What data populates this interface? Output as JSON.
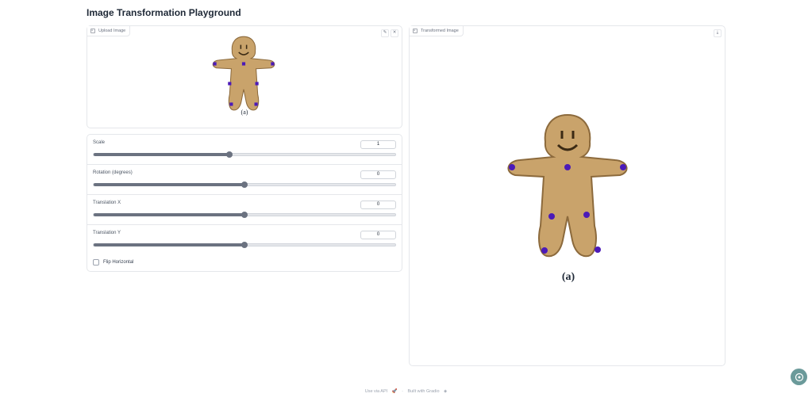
{
  "app": {
    "title": "Image Transformation Playground"
  },
  "upload": {
    "label": "Upload Image",
    "caption": "(a)"
  },
  "output": {
    "label": "Transformed Image",
    "caption": "(a)"
  },
  "controls": {
    "scale": {
      "label": "Scale",
      "value": "1",
      "fraction": 0.45
    },
    "rotation": {
      "label": "Rotation (degrees)",
      "value": "0",
      "fraction": 0.5
    },
    "translate_x": {
      "label": "Translation X",
      "value": "0",
      "fraction": 0.5
    },
    "translate_y": {
      "label": "Translation Y",
      "value": "0",
      "fraction": 0.5
    },
    "flip": {
      "label": "Flip Horizontal",
      "checked": false
    }
  },
  "footer": {
    "api": "Use via API",
    "separator": "·",
    "built": "Built with Gradio"
  },
  "colors": {
    "cookie": "#c9a36b",
    "cookie_dark": "#8c6a3c",
    "point": "#4b1ab8",
    "accent": "#6b7280"
  }
}
